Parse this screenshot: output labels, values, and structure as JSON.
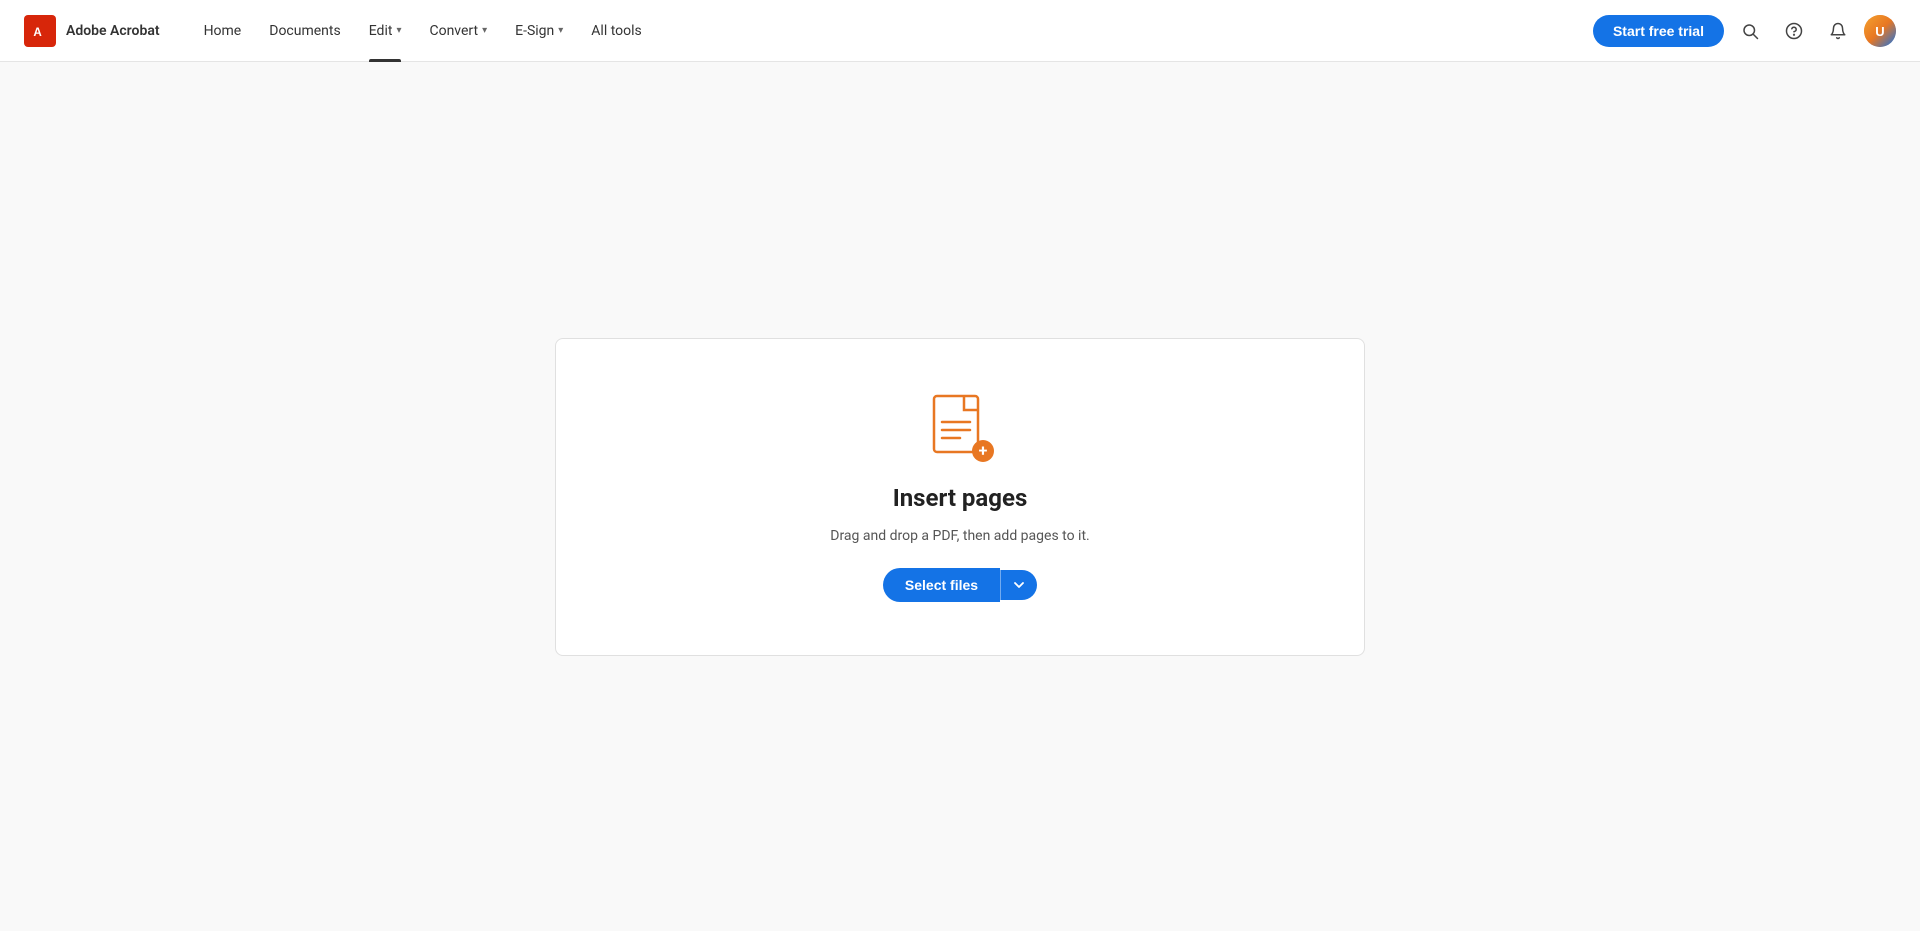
{
  "brand": {
    "logo_alt": "Adobe Acrobat logo",
    "app_name": "Adobe Acrobat"
  },
  "nav": {
    "items": [
      {
        "label": "Home",
        "active": false,
        "has_dropdown": false
      },
      {
        "label": "Documents",
        "active": false,
        "has_dropdown": false
      },
      {
        "label": "Edit",
        "active": true,
        "has_dropdown": true
      },
      {
        "label": "Convert",
        "active": false,
        "has_dropdown": true
      },
      {
        "label": "E-Sign",
        "active": false,
        "has_dropdown": true
      },
      {
        "label": "All tools",
        "active": false,
        "has_dropdown": false
      }
    ]
  },
  "header": {
    "trial_button": "Start free trial",
    "search_tooltip": "Search",
    "help_tooltip": "Help",
    "notifications_tooltip": "Notifications",
    "avatar_alt": "User avatar"
  },
  "main": {
    "icon_alt": "Insert pages icon",
    "title": "Insert pages",
    "subtitle": "Drag and drop a PDF, then add pages to it.",
    "select_files_label": "Select files",
    "dropdown_label": "▾"
  }
}
